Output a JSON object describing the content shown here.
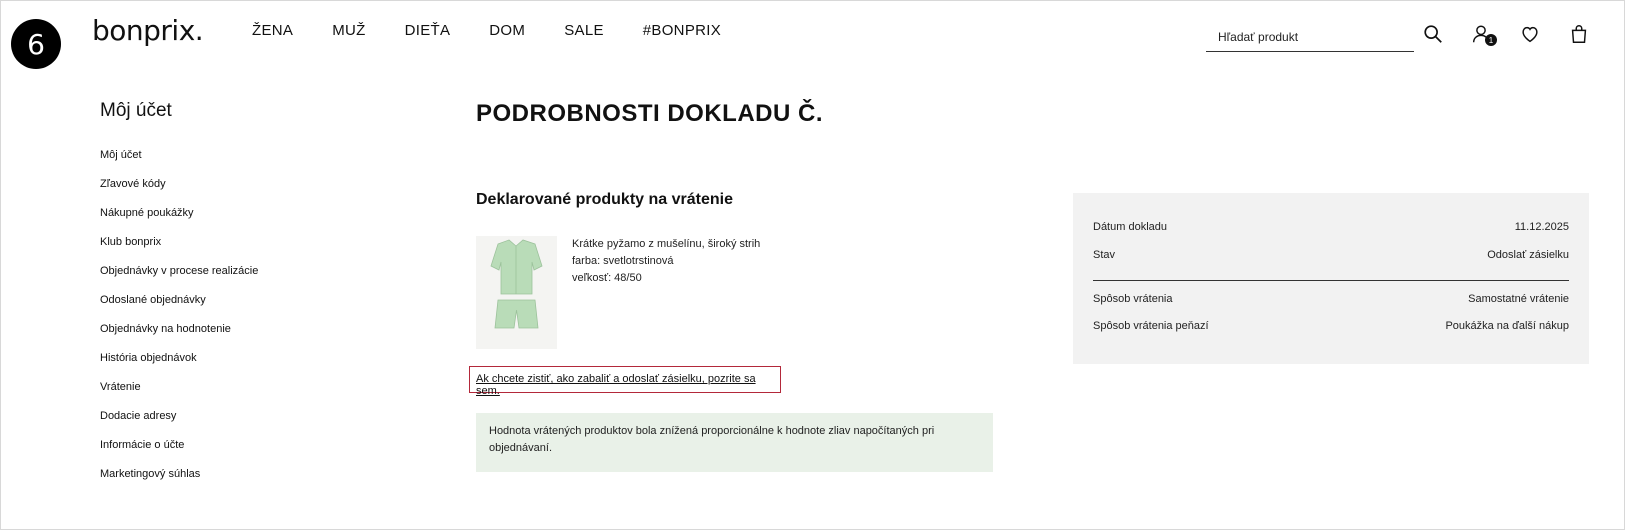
{
  "step_number": "6",
  "logo": "bonprix.",
  "nav": [
    "ŽENA",
    "MUŽ",
    "DIEŤA",
    "DOM",
    "SALE",
    "#BONPRIX"
  ],
  "search": {
    "placeholder": "Hľadať produkt"
  },
  "header_icons": [
    "search-icon",
    "user-icon",
    "heart-icon",
    "bag-icon"
  ],
  "account_badge": "1",
  "sidebar": {
    "title": "Môj účet",
    "items": [
      "Môj účet",
      "Zľavové kódy",
      "Nákupné poukážky",
      "Klub bonprix",
      "Objednávky v procese realizácie",
      "Odoslané objednávky",
      "Objednávky na hodnotenie",
      "História objednávok",
      "Vrátenie",
      "Dodacie adresy",
      "Informácie o účte",
      "Marketingový súhlas"
    ]
  },
  "main": {
    "title": "PODROBNOSTI DOKLADU Č.",
    "section_title": "Deklarované produkty na vrátenie",
    "product": {
      "name": "Krátke pyžamo z mušelínu, široký strih",
      "color": "farba: svetlotrstinová",
      "size": "veľkosť: 48/50"
    },
    "help_link": "Ak chcete zistiť, ako zabaliť a odoslať zásielku, pozrite sa sem.",
    "info": "Hodnota vrátených produktov bola znížená proporcionálne k hodnote zliav napočítaných pri objednávaní."
  },
  "details": {
    "rows": [
      {
        "label": "Dátum dokladu",
        "value": "11.12.2025"
      },
      {
        "label": "Stav",
        "value": "Odoslať zásielku"
      },
      {
        "label": "Spôsob vrátenia",
        "value": "Samostatné vrátenie"
      },
      {
        "label": "Spôsob vrátenia peňazí",
        "value": "Poukážka na ďalší nákup"
      }
    ]
  },
  "colors": {
    "highlight_border": "#b3283a",
    "info_bg": "#e9f1e8",
    "details_bg": "#f2f2f2",
    "product_green": "#b9dcb8"
  }
}
